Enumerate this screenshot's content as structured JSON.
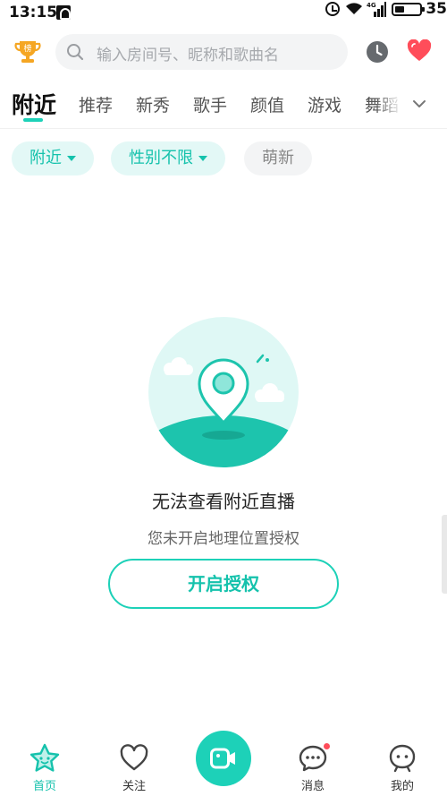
{
  "status_bar": {
    "time": "13:15",
    "battery_percent": "35",
    "network_label": "4G"
  },
  "header": {
    "trophy_badge": "榜",
    "search": {
      "placeholder": "输入房间号、昵称和歌曲名"
    },
    "icons": {
      "trophy": "trophy-icon",
      "search": "search-icon",
      "history": "clock-icon",
      "favorites": "heart-icon"
    }
  },
  "tabs": [
    {
      "label": "附近",
      "active": true
    },
    {
      "label": "推荐"
    },
    {
      "label": "新秀"
    },
    {
      "label": "歌手"
    },
    {
      "label": "颜值"
    },
    {
      "label": "游戏"
    },
    {
      "label": "舞蹈"
    }
  ],
  "filters": [
    {
      "label": "附近",
      "dropdown": true
    },
    {
      "label": "性别不限",
      "dropdown": true
    },
    {
      "label": "萌新",
      "dropdown": false
    }
  ],
  "empty_state": {
    "title": "无法查看附近直播",
    "subtitle": "您未开启地理位置授权",
    "button_label": "开启授权",
    "illustration": "location-pin-illustration"
  },
  "bottom_nav": [
    {
      "label": "首页",
      "icon": "star-home-icon",
      "active": true
    },
    {
      "label": "关注",
      "icon": "heart-outline-icon"
    },
    {
      "label": "",
      "icon": "video-camera-icon"
    },
    {
      "label": "消息",
      "icon": "message-bubble-icon",
      "has_unread": true
    },
    {
      "label": "我的",
      "icon": "profile-icon"
    }
  ],
  "colors": {
    "accent": "#1dd1b8",
    "accent_text": "#15c2ac",
    "chip_bg": "#e3f8f6",
    "heart": "#ff4d5a",
    "trophy": "#f5a623"
  }
}
